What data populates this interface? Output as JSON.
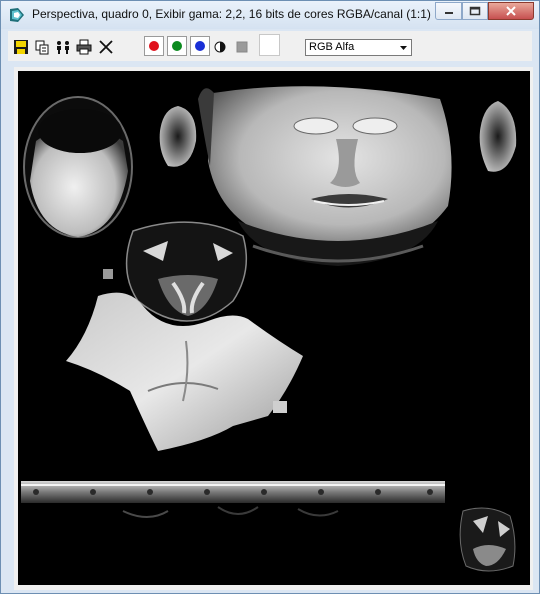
{
  "window": {
    "title": "Perspectiva, quadro 0, Exibir gama: 2,2, 16 bits de cores RGBA/canal (1:1)",
    "app_icon": "3ds-max-icon"
  },
  "caption_buttons": [
    "minimize-icon",
    "maximize-icon",
    "close-icon"
  ],
  "toolbar": {
    "tools": [
      "save-icon",
      "copy-icon",
      "clone-window-icon",
      "print-icon",
      "clear-icon"
    ],
    "channels": [
      {
        "name": "red-channel",
        "color": "#e0111c"
      },
      {
        "name": "green-channel",
        "color": "#0b8a1e"
      },
      {
        "name": "blue-channel",
        "color": "#1a2fd6"
      }
    ],
    "monochrome_icon": "monochrome-icon",
    "clear_icon": "grey-square-icon",
    "swatch_color": "#ffffff",
    "channel_select": {
      "selected": "RGB Alfa"
    }
  },
  "viewport": {
    "content": "rendered-texture-map",
    "background": "#000000"
  }
}
